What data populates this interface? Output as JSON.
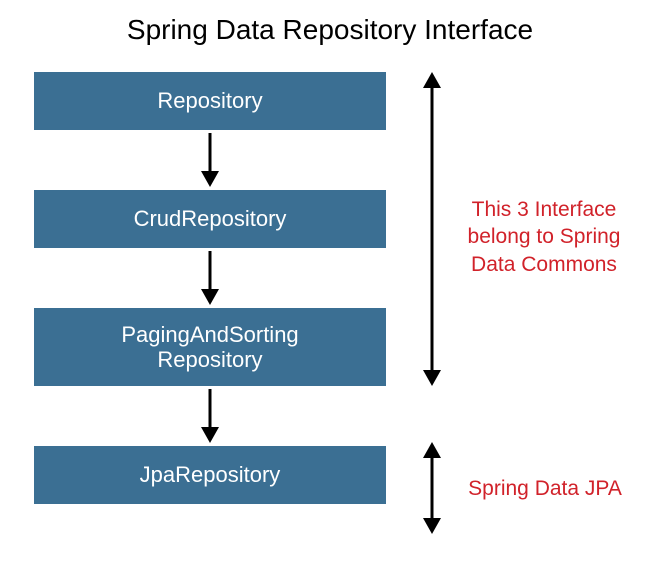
{
  "title": "Spring Data Repository Interface",
  "boxes": [
    {
      "label": "Repository"
    },
    {
      "label": "CrudRepository"
    },
    {
      "label": "PagingAndSorting\nRepository"
    },
    {
      "label": "JpaRepository"
    }
  ],
  "annotations": {
    "group1": "This 3 Interface belong to Spring Data Commons",
    "group2": "Spring Data JPA"
  },
  "colors": {
    "box_bg": "#3b6f93",
    "box_text": "#ffffff",
    "note_text": "#d1222a"
  }
}
